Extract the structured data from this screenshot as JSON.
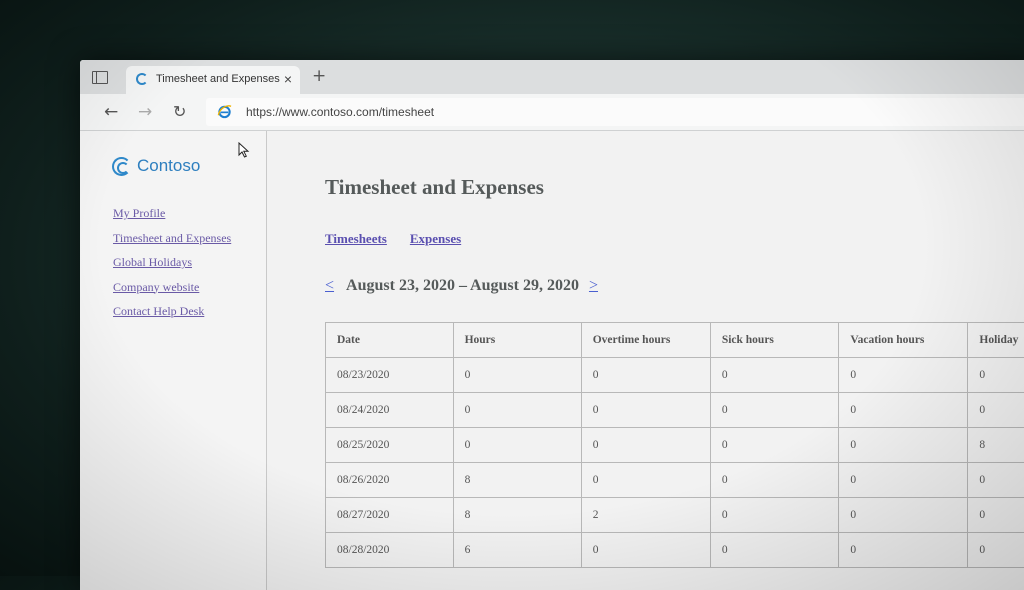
{
  "browser": {
    "tab_title": "Timesheet and Expenses",
    "tab_close": "×",
    "new_tab": "+",
    "url": "https://www.contoso.com/timesheet",
    "back": "←",
    "forward": "→",
    "refresh": "↻"
  },
  "sidebar": {
    "logo_text": "Contoso",
    "items": [
      {
        "label": "My Profile"
      },
      {
        "label": "Timesheet and Expenses"
      },
      {
        "label": "Global Holidays"
      },
      {
        "label": "Company website"
      },
      {
        "label": "Contact Help Desk"
      }
    ]
  },
  "main": {
    "title": "Timesheet and Expenses",
    "tabs": [
      {
        "label": "Timesheets"
      },
      {
        "label": "Expenses"
      }
    ],
    "week": {
      "prev": "<",
      "range": "August 23, 2020 – August 29, 2020",
      "next": ">"
    },
    "table": {
      "headers": [
        "Date",
        "Hours",
        "Overtime hours",
        "Sick hours",
        "Vacation hours",
        "Holiday"
      ],
      "rows": [
        [
          "08/23/2020",
          "0",
          "0",
          "0",
          "0",
          "0"
        ],
        [
          "08/24/2020",
          "0",
          "0",
          "0",
          "0",
          "0"
        ],
        [
          "08/25/2020",
          "0",
          "0",
          "0",
          "0",
          "8"
        ],
        [
          "08/26/2020",
          "8",
          "0",
          "0",
          "0",
          "0"
        ],
        [
          "08/27/2020",
          "8",
          "2",
          "0",
          "0",
          "0"
        ],
        [
          "08/28/2020",
          "6",
          "0",
          "0",
          "0",
          "0"
        ]
      ]
    }
  },
  "colors": {
    "accent": "#2e88c9",
    "link": "#6a5aa6",
    "nav_arrow": "#4a5fd0"
  }
}
